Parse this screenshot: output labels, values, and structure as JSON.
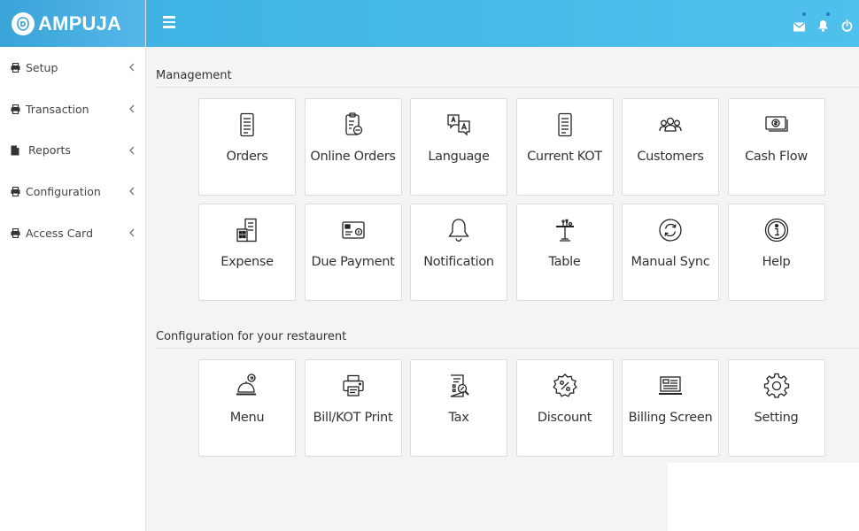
{
  "brand": {
    "name": "AMPUJA"
  },
  "sidebar": {
    "items": [
      {
        "label": "Setup",
        "icon": "printer-icon"
      },
      {
        "label": "Transaction",
        "icon": "printer-icon"
      },
      {
        "label": "Reports",
        "icon": "file-icon"
      },
      {
        "label": "Configuration",
        "icon": "printer-icon"
      },
      {
        "label": "Access Card",
        "icon": "printer-icon"
      }
    ]
  },
  "topbar": {
    "icons": [
      "envelope-icon",
      "bell-icon",
      "power-icon"
    ]
  },
  "sections": {
    "management": {
      "title": "Management",
      "tiles": [
        {
          "label": "Orders",
          "icon": "orders-icon"
        },
        {
          "label": "Online Orders",
          "icon": "online-orders-icon"
        },
        {
          "label": "Language",
          "icon": "language-icon"
        },
        {
          "label": "Current KOT",
          "icon": "kot-icon"
        },
        {
          "label": "Customers",
          "icon": "customers-icon"
        },
        {
          "label": "Cash Flow",
          "icon": "cash-flow-icon"
        },
        {
          "label": "Expense",
          "icon": "expense-icon"
        },
        {
          "label": "Due Payment",
          "icon": "due-payment-icon"
        },
        {
          "label": "Notification",
          "icon": "bell-icon"
        },
        {
          "label": "Table",
          "icon": "table-icon"
        },
        {
          "label": "Manual Sync",
          "icon": "sync-icon"
        },
        {
          "label": "Help",
          "icon": "help-icon"
        }
      ]
    },
    "configuration": {
      "title": "Configuration for your restaurent",
      "tiles": [
        {
          "label": "Menu",
          "icon": "menu-cloche-icon"
        },
        {
          "label": "Bill/KOT Print",
          "icon": "printer-icon"
        },
        {
          "label": "Tax",
          "icon": "tax-icon"
        },
        {
          "label": "Discount",
          "icon": "discount-icon"
        },
        {
          "label": "Billing Screen",
          "icon": "billing-screen-icon"
        },
        {
          "label": "Setting",
          "icon": "gear-icon"
        }
      ]
    }
  },
  "colors": {
    "accent": "#3fb3e3",
    "notification_dot": "#2d73c9"
  }
}
